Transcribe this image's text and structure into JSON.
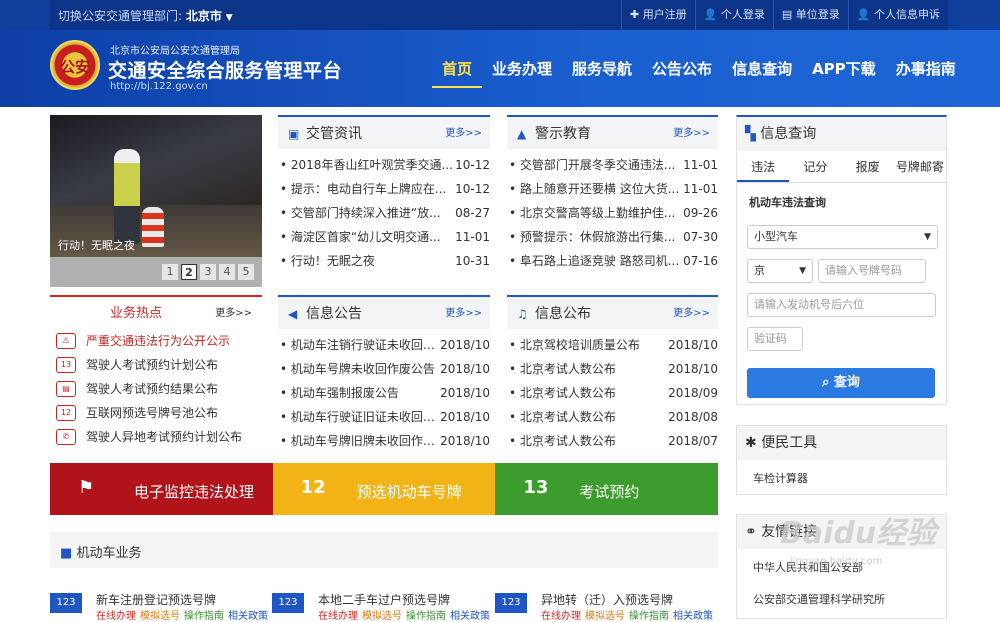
{
  "topbar": {
    "region_label": "切换公安交通管理部门:",
    "region_value": "北京市",
    "links": [
      "用户注册",
      "个人登录",
      "单位登录",
      "个人信息申诉"
    ]
  },
  "header": {
    "emblem_text": "公安",
    "org": "北京市公安局公安交通管理局",
    "platform": "交通安全综合服务管理平台",
    "url": "http://bj.122.gov.cn",
    "nav": [
      "首页",
      "业务办理",
      "服务导航",
      "公告公布",
      "信息查询",
      "APP下载",
      "办事指南"
    ]
  },
  "slider": {
    "caption": "行动！无眠之夜",
    "pages": [
      "1",
      "2",
      "3",
      "4",
      "5"
    ],
    "active_page": "2"
  },
  "news": {
    "title": "交管资讯",
    "more": "更多>>",
    "items": [
      {
        "t": "2018年香山红叶观赏季交通...",
        "d": "10-12"
      },
      {
        "t": "提示：电动自行车上牌应在...",
        "d": "10-12"
      },
      {
        "t": "交管部门持续深入推进“放...",
        "d": "08-27"
      },
      {
        "t": "海淀区首家“幼儿文明交通...",
        "d": "11-01"
      },
      {
        "t": "行动！无眠之夜",
        "d": "10-31"
      }
    ]
  },
  "warning": {
    "title": "警示教育",
    "more": "更多>>",
    "items": [
      {
        "t": "交管部门开展冬季交通违法...",
        "d": "11-01"
      },
      {
        "t": "路上随意开还要横 这位大货...",
        "d": "11-01"
      },
      {
        "t": "北京交警高等级上勤维护佳...",
        "d": "09-26"
      },
      {
        "t": "预警提示：休假旅游出行集...",
        "d": "07-30"
      },
      {
        "t": "阜石路上追逐竞驶 路怒司机...",
        "d": "07-16"
      }
    ]
  },
  "hot": {
    "title": "业务热点",
    "more": "更多>>",
    "items": [
      "严重交通违法行为公开公示",
      "驾驶人考试预约计划公布",
      "驾驶人考试预约结果公布",
      "互联网预选号牌号池公布",
      "驾驶人异地考试预约计划公布"
    ]
  },
  "notice": {
    "title": "信息公告",
    "more": "更多>>",
    "items": [
      {
        "t": "机动车注销行驶证未收回作...",
        "d": "2018/10"
      },
      {
        "t": "机动车号牌未收回作废公告",
        "d": "2018/10"
      },
      {
        "t": "机动车强制报废公告",
        "d": "2018/10"
      },
      {
        "t": "机动车行驶证旧证未收回作...",
        "d": "2018/10"
      },
      {
        "t": "机动车号牌旧牌未收回作废...",
        "d": "2018/10"
      }
    ]
  },
  "publish": {
    "title": "信息公布",
    "more": "更多>>",
    "items": [
      {
        "t": "北京驾校培训质量公布",
        "d": "2018/10"
      },
      {
        "t": "北京考试人数公布",
        "d": "2018/10"
      },
      {
        "t": "北京考试人数公布",
        "d": "2018/09"
      },
      {
        "t": "北京考试人数公布",
        "d": "2018/08"
      },
      {
        "t": "北京考试人数公布",
        "d": "2018/07"
      }
    ]
  },
  "quick": [
    {
      "label": "电子监控违法处理",
      "color": "#b0141a",
      "icon": "flag-icon"
    },
    {
      "label": "预选机动车号牌",
      "color": "#f2b316",
      "icon": "plate-icon"
    },
    {
      "label": "考试预约",
      "color": "#3d9c2e",
      "icon": "calendar-icon"
    }
  ],
  "quick_icons": [
    "⚑",
    "12",
    "13"
  ],
  "vehicle": {
    "title": "机动车业务",
    "items": [
      {
        "title": "新车注册登记预选号牌",
        "icon_text": "123"
      },
      {
        "title": "本地二手车过户预选号牌",
        "icon_text": "123"
      },
      {
        "title": "异地转（迁）入预选号牌",
        "icon_text": "123"
      }
    ],
    "actions": [
      "在线办理",
      "模拟选号",
      "操作指南",
      "相关政策"
    ]
  },
  "query": {
    "title": "信息查询",
    "tabs": [
      "违法",
      "记分",
      "报废",
      "号牌邮寄"
    ],
    "subtitle": "机动车违法查询",
    "vehicle_type": "小型汽车",
    "province": "京",
    "plate_placeholder": "请输入号牌号码",
    "engine_placeholder": "请输入发动机号后六位",
    "captcha_placeholder": "验证码",
    "button": "查询"
  },
  "tools": {
    "title": "便民工具",
    "item": "车检计算器"
  },
  "links": {
    "title": "友情链接",
    "items": [
      "中华人民共和国公安部",
      "公安部交通管理科学研究所"
    ]
  },
  "watermark": {
    "text": "Baidu经验",
    "sub": "jingyan.baidu.com"
  }
}
